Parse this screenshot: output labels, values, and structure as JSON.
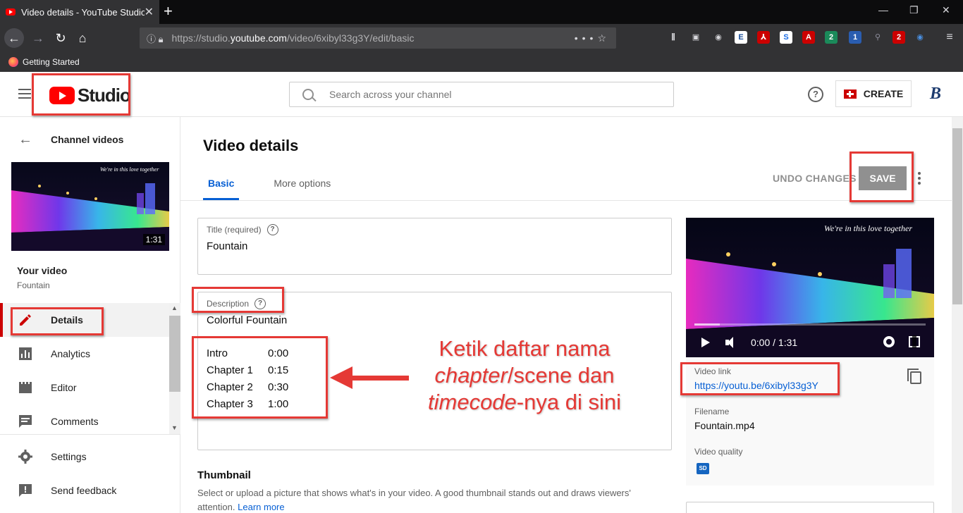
{
  "browser": {
    "tab_title": "Video details - YouTube Studio",
    "url_prefix": "https://studio.",
    "url_host": "youtube.com",
    "url_path": "/video/6xibyl33g3Y/edit/basic",
    "bookmark": "Getting Started",
    "ext_badges": [
      "2",
      "1",
      "2"
    ]
  },
  "header": {
    "logo_text": "Studio",
    "search_placeholder": "Search across your channel",
    "create_label": "CREATE",
    "avatar_letter": "B"
  },
  "sidebar": {
    "back_label": "Channel videos",
    "thumb_caption": "We're in this love together",
    "thumb_duration": "1:31",
    "your_video_label": "Your video",
    "video_name": "Fountain",
    "menu": [
      {
        "label": "Details",
        "icon": "pencil-icon"
      },
      {
        "label": "Analytics",
        "icon": "analytics-icon"
      },
      {
        "label": "Editor",
        "icon": "editor-icon"
      },
      {
        "label": "Comments",
        "icon": "comments-icon"
      }
    ],
    "bottom": [
      {
        "label": "Settings",
        "icon": "gear-icon"
      },
      {
        "label": "Send feedback",
        "icon": "feedback-icon"
      }
    ]
  },
  "main": {
    "title": "Video details",
    "tabs": [
      "Basic",
      "More options"
    ],
    "undo_label": "UNDO CHANGES",
    "save_label": "SAVE",
    "title_field": {
      "label": "Title (required)",
      "value": "Fountain"
    },
    "description": {
      "label": "Description",
      "first_line": "Colorful Fountain",
      "chapters": [
        {
          "name": "Intro",
          "time": "0:00"
        },
        {
          "name": "Chapter 1",
          "time": "0:15"
        },
        {
          "name": "Chapter 2",
          "time": "0:30"
        },
        {
          "name": "Chapter 3",
          "time": "1:00"
        }
      ]
    },
    "thumbnail": {
      "title": "Thumbnail",
      "text": "Select or upload a picture that shows what's in your video. A good thumbnail stands out and draws viewers' attention.",
      "learn_more": "Learn more"
    }
  },
  "preview": {
    "caption": "We're in this love together",
    "time": "0:00 / 1:31",
    "video_link_label": "Video link",
    "video_link": "https://youtu.be/6xibyl33g3Y",
    "filename_label": "Filename",
    "filename": "Fountain.mp4",
    "quality_label": "Video quality",
    "quality_badge": "SD"
  },
  "annotation": {
    "line1": "Ketik daftar nama",
    "line2_italic": "chapter",
    "line2_rest": "/scene dan",
    "line3_italic": "timecode",
    "line3_rest": "-nya di sini",
    "color": "#e53935"
  }
}
